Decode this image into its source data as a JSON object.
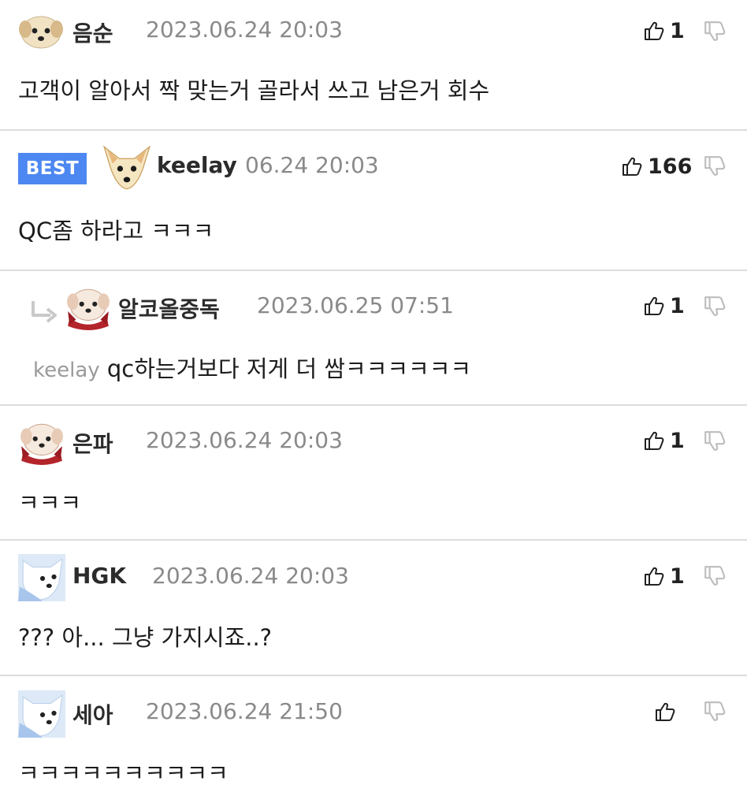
{
  "comments": [
    {
      "name": "음순",
      "date": "2023.06.24 20:03",
      "body": "고객이 알아서 짝 맞는거 골라서 쓰고 남은거 회수",
      "likes": "1",
      "avatar": "puppy-face-icon"
    },
    {
      "best_label": "BEST",
      "name": "keelay",
      "date": "06.24 20:03",
      "body": "QC좀 하라고 ㅋㅋㅋ",
      "likes": "166",
      "avatar": "chihuahua-icon"
    },
    {
      "name": "알코올중독",
      "date": "2023.06.25 07:51",
      "mention": "keelay",
      "body": "qc하는거보다 저게 더 쌈ㅋㅋㅋㅋㅋㅋ",
      "likes": "1",
      "avatar": "dog-scarf-icon",
      "is_reply": true
    },
    {
      "name": "은파",
      "date": "2023.06.24 20:03",
      "body": "ㅋㅋㅋ",
      "likes": "1",
      "avatar": "dog-scarf-icon"
    },
    {
      "name": "HGK",
      "date": "2023.06.24 20:03",
      "body": "??? 아... 그냥 가지시죠..?",
      "likes": "1",
      "avatar": "white-dog-icon"
    },
    {
      "name": "세아",
      "date": "2023.06.24 21:50",
      "body": "ㅋㅋㅋㅋㅋㅋㅋㅋㅋㅋ",
      "likes": "",
      "avatar": "white-dog-icon"
    }
  ],
  "icons": {
    "like": "thumbs-up-icon",
    "dislike": "thumbs-down-icon",
    "reply": "reply-arrow-icon"
  },
  "colors": {
    "best_badge": "#4d87f1",
    "date": "#8a8a8a",
    "separator": "#dcdcdc"
  }
}
